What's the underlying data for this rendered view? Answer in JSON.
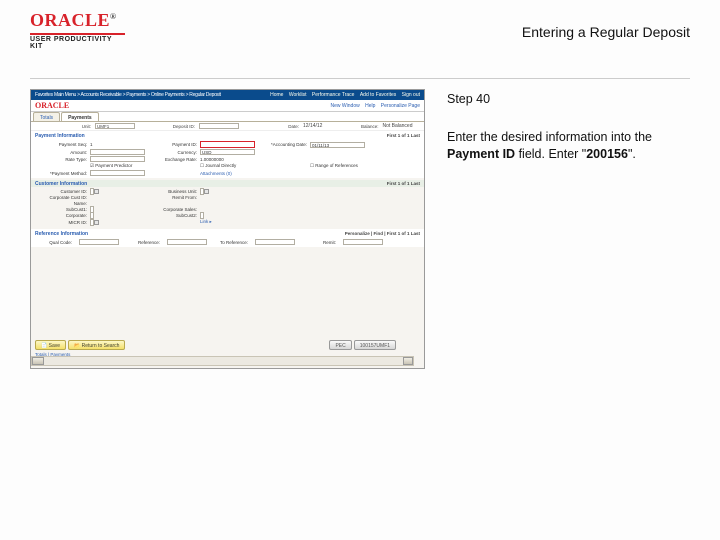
{
  "header": {
    "brand": "ORACLE",
    "upk": "USER PRODUCTIVITY KIT",
    "title": "Entering a Regular Deposit"
  },
  "step": {
    "label": "Step 40",
    "text_pre": "Enter the desired information into the ",
    "bold1": "Payment ID",
    "text_mid": " field. Enter \"",
    "bold2": "200156",
    "text_post": "\"."
  },
  "app": {
    "breadcrumb": "Favorites    Main Menu  >  Accounts Receivable  >  Payments  >  Online Payments  >  Regular Deposit",
    "toplinks": [
      "Home",
      "Worklist",
      "Performance Trace",
      "Add to Favorites",
      "Sign out"
    ],
    "logo": "ORACLE",
    "nav_links": [
      "New Window",
      "Help",
      "Personalize Page"
    ],
    "tabs": [
      "Totals",
      "Payments"
    ],
    "row1": {
      "unit_lbl": "Unit:",
      "unit_val": "UMF1",
      "dep_lbl": "Deposit ID:",
      "dep_val": "",
      "date_lbl": "Date:",
      "date_val": "12/14/12",
      "bal_lbl": "Balance:",
      "bal_val": "Not Balanced"
    },
    "pager1": "First  1 of 1  Last",
    "pay": {
      "head": "Payment Information",
      "seq_lbl": "Payment Seq:",
      "seq_val": "1",
      "id_lbl": "Payment ID:",
      "id_val": "",
      "acct_lbl": "*Accounting Date:",
      "acct_val": "01/11/13",
      "amt_lbl": "Amount:",
      "amt_val": "",
      "cur_lbl": "Currency:",
      "cur_val": "USD",
      "rate_lbl": "Rate Type:",
      "rate_val": "",
      "ex_lbl": "Exchange Rate:",
      "ex_val": "1.00000000",
      "pp_lbl": "Payment Predictor",
      "je_lbl": "Journal Directly",
      "ror_lbl": "Range of References",
      "pm_lbl": "*Payment Method:",
      "pm_val": "",
      "attach": "Attachments (0)"
    },
    "cust": {
      "head": "Customer Information",
      "pager": "First  1 of 1  Last",
      "custid_lbl": "Customer ID:",
      "custid_val": "",
      "bu_lbl": "Business Unit:",
      "bu_val": "",
      "corpid_lbl": "Corporate Cust ID:",
      "corpid_val": "",
      "remit_lbl": "Remit From:",
      "remit_val": "",
      "name_lbl": "Name:",
      "name_val": "",
      "subc_lbl": "SubCust1:",
      "sub2_lbl": "SubCust2:",
      "corp_lbl": "Corporate:",
      "corp_val": "",
      "micr_lbl": "MICR ID:",
      "micr_val": "",
      "link": "Link  ▸"
    },
    "elec": {
      "head": "Reference Information",
      "pager": "Personalize | Find |     First  1 of 1  Last",
      "q_lbl": "Qual Code:",
      "r_lbl": "Reference:",
      "t_lbl": "To Reference:",
      "rt_lbl": "Remit:"
    },
    "buttons": {
      "save": "Save",
      "return": "Return to Search",
      "pc": "PEC",
      "ts": "100157UMF1"
    },
    "footer_links": "Totals | Payments"
  }
}
